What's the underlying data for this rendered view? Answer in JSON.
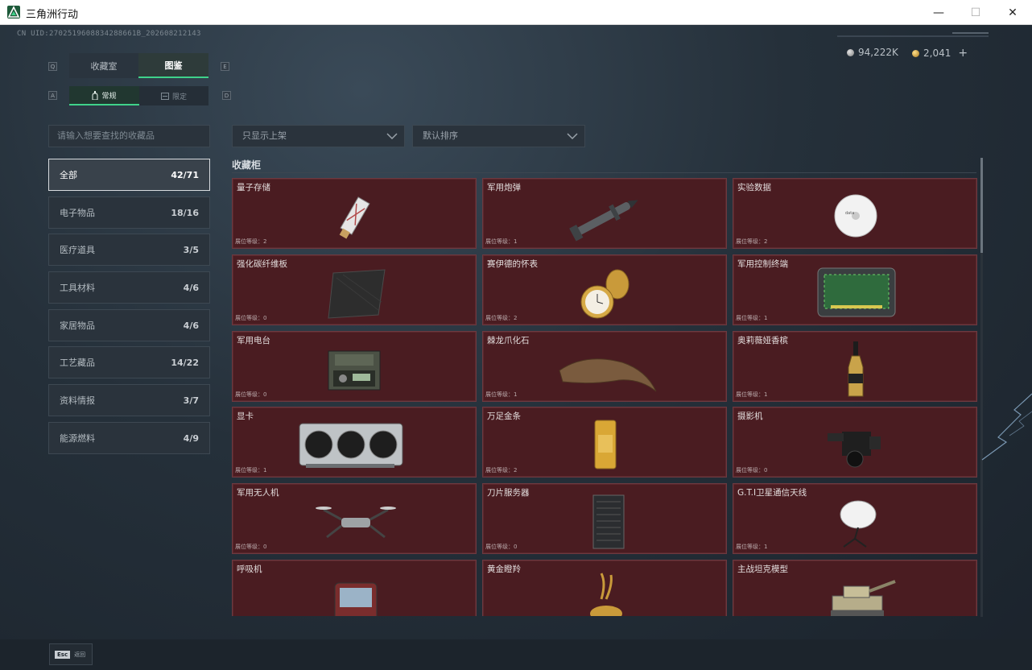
{
  "window": {
    "title": "三角洲行动",
    "minimize": "—",
    "maximize": "☐",
    "close": "✕"
  },
  "header": {
    "uid": "CN UID:2702519608834288661B_202608212143",
    "currency": [
      {
        "icon": "silver-coin-icon",
        "value": "94,222K"
      },
      {
        "icon": "gold-coin-icon",
        "value": "2,041"
      }
    ],
    "add_label": "+"
  },
  "tabs": {
    "key_left": "Q",
    "key_right": "E",
    "items": [
      {
        "label": "收藏室",
        "active": false
      },
      {
        "label": "图鉴",
        "active": true
      }
    ]
  },
  "subtabs": {
    "key_left": "A",
    "key_right": "D",
    "items": [
      {
        "label": "常规",
        "icon": "bottle-icon",
        "active": true
      },
      {
        "label": "限定",
        "icon": "card-icon",
        "active": false
      }
    ]
  },
  "search": {
    "placeholder": "请输入想要查找的收藏品"
  },
  "filters": {
    "shelf": "只显示上架",
    "sort": "默认排序"
  },
  "categories": [
    {
      "label": "全部",
      "count": "42/71",
      "active": true
    },
    {
      "label": "电子物品",
      "count": "18/16",
      "active": false
    },
    {
      "label": "医疗道具",
      "count": "3/5",
      "active": false
    },
    {
      "label": "工具材料",
      "count": "4/6",
      "active": false
    },
    {
      "label": "家居物品",
      "count": "4/6",
      "active": false
    },
    {
      "label": "工艺藏品",
      "count": "14/22",
      "active": false
    },
    {
      "label": "资料情报",
      "count": "3/7",
      "active": false
    },
    {
      "label": "能源燃料",
      "count": "4/9",
      "active": false
    }
  ],
  "cabinet": {
    "title": "收藏柜",
    "items": [
      {
        "name": "量子存储",
        "level": "展位等级：2",
        "icon": "usb-drive-icon"
      },
      {
        "name": "军用炮弹",
        "level": "展位等级：1",
        "icon": "missile-icon"
      },
      {
        "name": "实验数据",
        "level": "展位等级：2",
        "icon": "disc-icon"
      },
      {
        "name": "强化碳纤维板",
        "level": "展位等级：0",
        "icon": "carbon-plate-icon"
      },
      {
        "name": "赛伊德的怀表",
        "level": "展位等级：2",
        "icon": "pocket-watch-icon"
      },
      {
        "name": "军用控制终端",
        "level": "展位等级：1",
        "icon": "control-terminal-icon"
      },
      {
        "name": "军用电台",
        "level": "展位等级：0",
        "icon": "radio-icon"
      },
      {
        "name": "棘龙爪化石",
        "level": "展位等级：1",
        "icon": "claw-fossil-icon"
      },
      {
        "name": "奥莉薇娅香槟",
        "level": "展位等级：1",
        "icon": "champagne-icon"
      },
      {
        "name": "显卡",
        "level": "展位等级：1",
        "icon": "graphics-card-icon"
      },
      {
        "name": "万足金条",
        "level": "展位等级：2",
        "icon": "gold-bar-icon"
      },
      {
        "name": "摄影机",
        "level": "展位等级：0",
        "icon": "video-camera-icon"
      },
      {
        "name": "军用无人机",
        "level": "展位等级：0",
        "icon": "drone-icon"
      },
      {
        "name": "刀片服务器",
        "level": "展位等级：0",
        "icon": "server-icon"
      },
      {
        "name": "G.T.I卫星通信天线",
        "level": "展位等级：1",
        "icon": "satellite-dish-icon"
      },
      {
        "name": "呼吸机",
        "level": "",
        "icon": "ventilator-icon"
      },
      {
        "name": "黄金瞪羚",
        "level": "",
        "icon": "gold-gazelle-icon"
      },
      {
        "name": "主战坦克模型",
        "level": "",
        "icon": "tank-model-icon"
      }
    ]
  },
  "footer": {
    "esc_key": "Esc",
    "esc_label": "返回"
  },
  "colors": {
    "accent": "#3fd28a",
    "card_bg": "#4a1c21",
    "card_border": "#6d3a40"
  }
}
